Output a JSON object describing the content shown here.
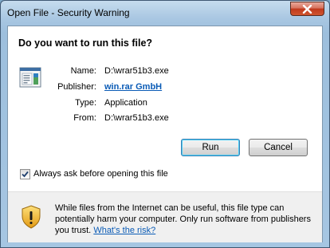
{
  "window": {
    "title": "Open File - Security Warning"
  },
  "dialog": {
    "heading": "Do you want to run this file?",
    "fields": [
      {
        "label": "Name:",
        "value": "D:\\wrar51b3.exe"
      },
      {
        "label": "Publisher:",
        "value": "win.rar GmbH"
      },
      {
        "label": "Type:",
        "value": "Application"
      },
      {
        "label": "From:",
        "value": "D:\\wrar51b3.exe"
      }
    ],
    "run_label": "Run",
    "cancel_label": "Cancel",
    "checkbox": {
      "label": "Always ask before opening this file",
      "checked": true
    }
  },
  "footer": {
    "line1": "While files from the Internet can be useful, this file type can",
    "line2": "potentially harm your computer. Only run software from publishers",
    "line3_prefix": "you trust.",
    "risk_link": "What's the risk?"
  },
  "colors": {
    "link": "#0a5bb6",
    "close_button": "#c0391d",
    "shield": "#f2b634"
  }
}
